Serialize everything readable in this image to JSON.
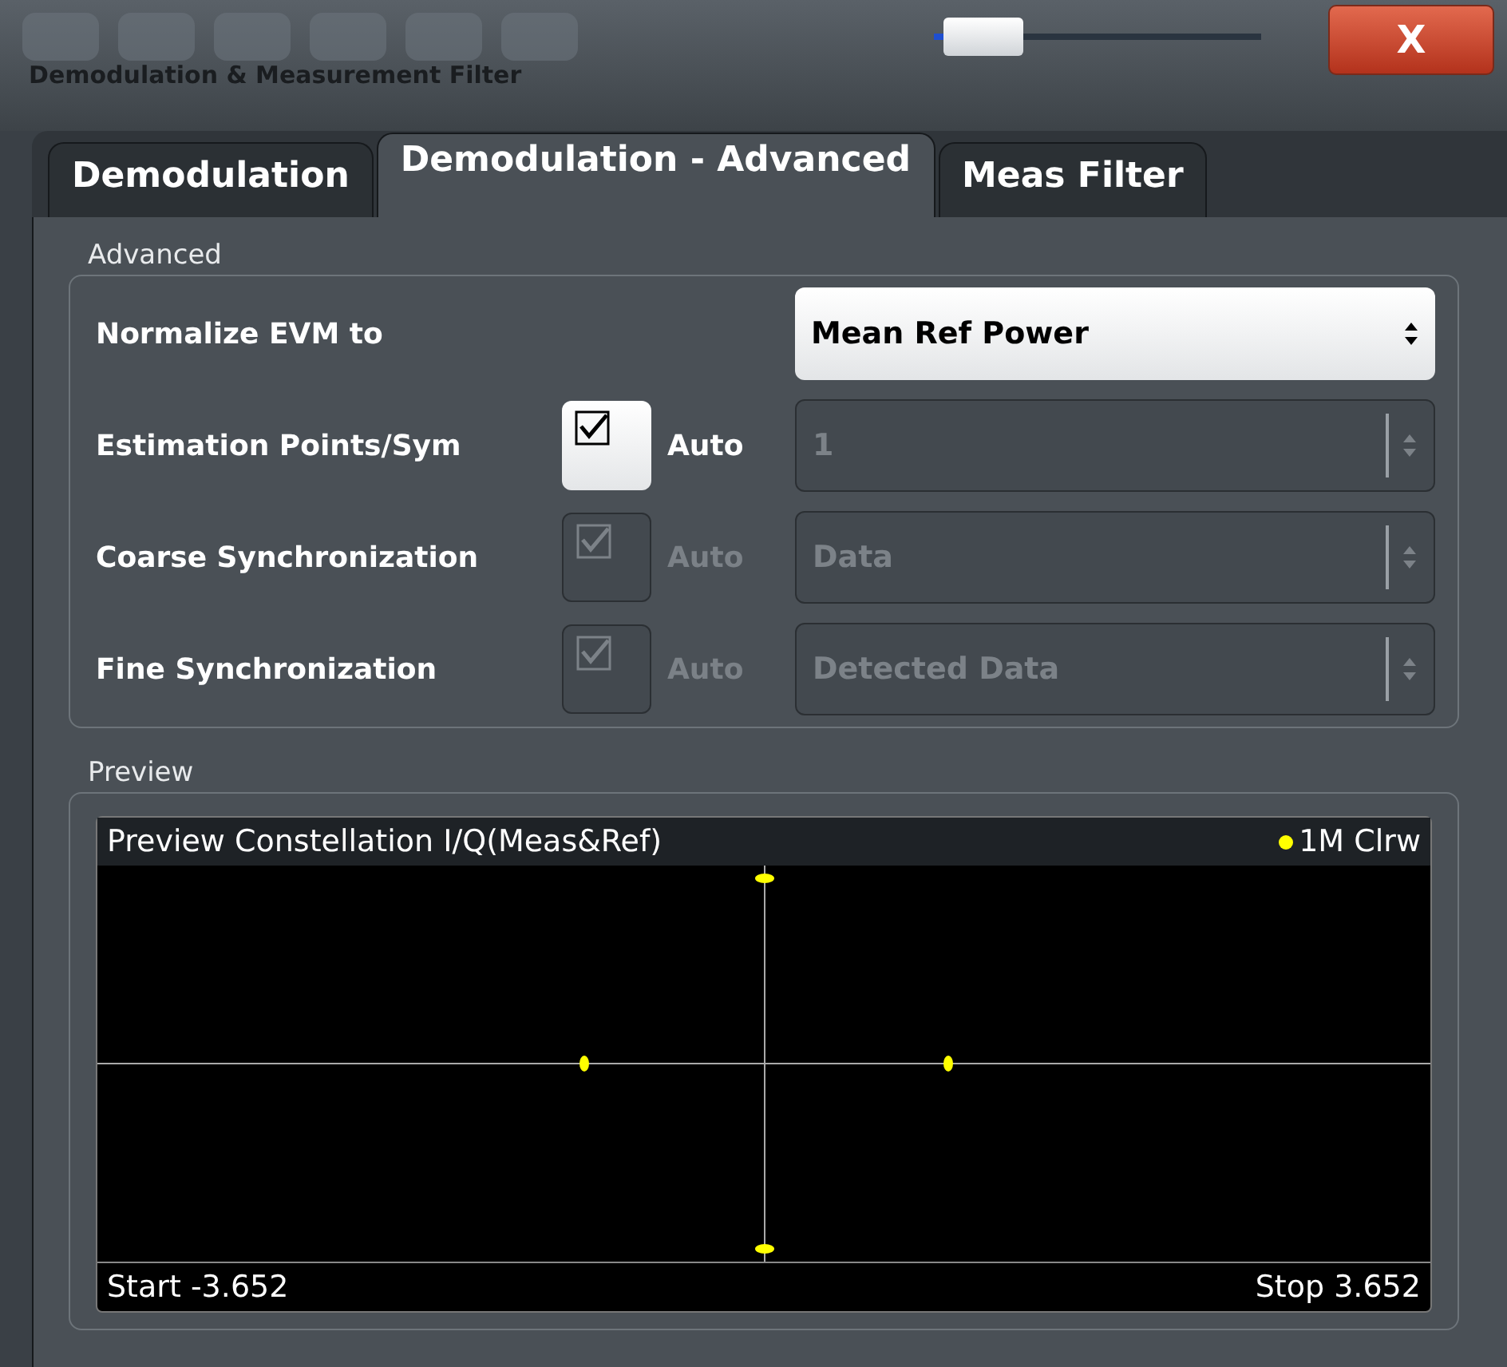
{
  "toolbar": {
    "transparency_slider": {
      "level": 0.1
    },
    "close_button": "X"
  },
  "dialog": {
    "title": "Demodulation & Measurement Filter"
  },
  "tabs": [
    {
      "label": "Demodulation",
      "selected": false
    },
    {
      "label": "Demodulation - Advanced",
      "selected": true
    },
    {
      "label": "Meas Filter",
      "selected": false
    }
  ],
  "advanced": {
    "title": "Advanced",
    "rows": [
      {
        "kind": "dropdown",
        "label": "Normalize EVM to",
        "value": "Mean Ref Power",
        "disabled": false
      },
      {
        "kind": "auto",
        "label": "Estimation Points/Sym",
        "auto_label": "Auto",
        "auto_checked": true,
        "auto_disabled": false,
        "value": "1",
        "disabled": true
      },
      {
        "kind": "auto",
        "label": "Coarse Synchronization",
        "auto_label": "Auto",
        "auto_checked": true,
        "auto_disabled": true,
        "value": "Data",
        "disabled": true
      },
      {
        "kind": "auto",
        "label": "Fine Synchronization",
        "auto_label": "Auto",
        "auto_checked": true,
        "auto_disabled": true,
        "value": "Detected Data",
        "disabled": true
      }
    ]
  },
  "preview": {
    "title": "Preview",
    "plot": {
      "title": "Preview Constellation I/Q(Meas&Ref)",
      "trace": {
        "label": "1M Clrw",
        "color": "#ffff00"
      },
      "start": "Start -3.652",
      "stop": "Stop 3.652"
    }
  }
}
